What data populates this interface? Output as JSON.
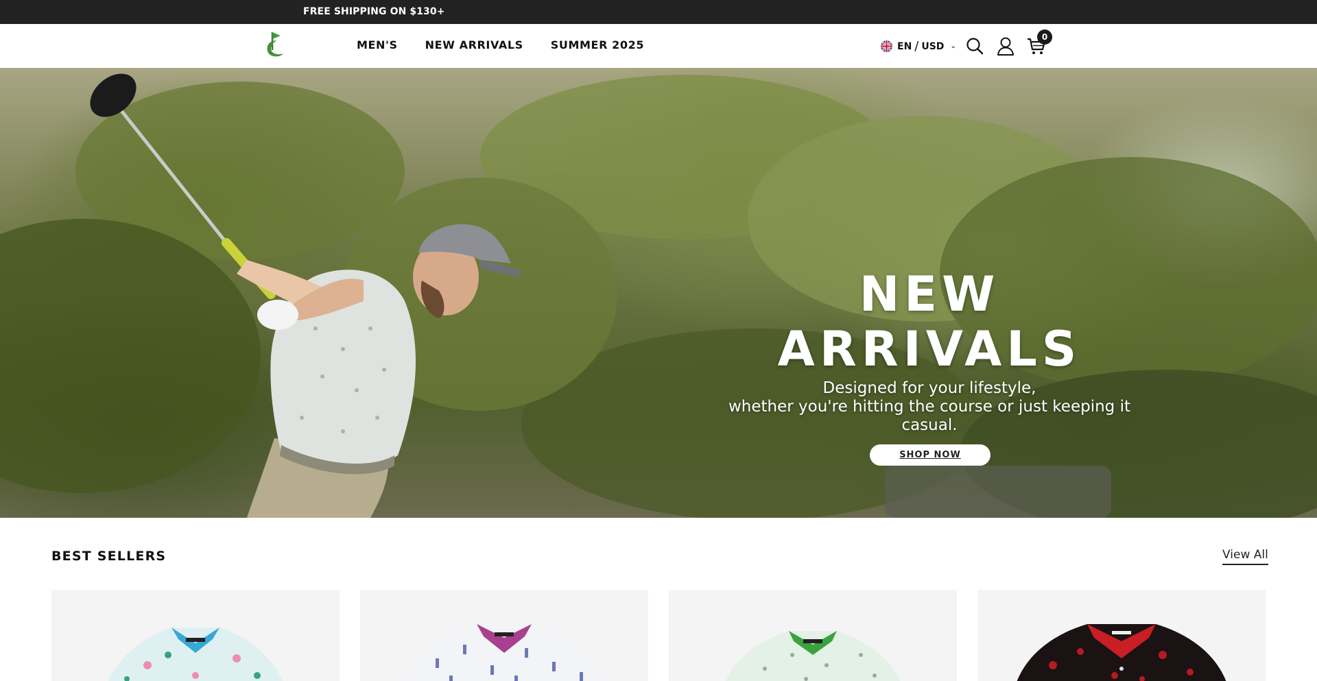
{
  "announcement": {
    "text": "FREE SHIPPING ON $130+"
  },
  "header": {
    "logo_icon": "golf-flag-logo-icon",
    "nav": [
      {
        "label": "MEN'S"
      },
      {
        "label": "NEW ARRIVALS"
      },
      {
        "label": "SUMMER 2025"
      }
    ],
    "locale": {
      "language": "EN",
      "separator": "/",
      "currency": "USD",
      "flag_icon": "uk-flag-icon"
    },
    "icons": {
      "search": "search-icon",
      "account": "user-icon",
      "cart": "cart-icon"
    },
    "cart_count": "0"
  },
  "hero": {
    "title": "NEW ARRIVALS",
    "subtitle_line1": "Designed for your lifestyle,",
    "subtitle_line2": "whether you're hitting the course or just keeping it casual.",
    "cta_label": "SHOP NOW"
  },
  "best_sellers": {
    "heading": "BEST SELLERS",
    "view_all_label": "View All",
    "products": [
      {
        "collar_color": "#35a9d6",
        "pattern": "flamingo-palm",
        "body_color": "#dff0f2"
      },
      {
        "collar_color": "#a8408f",
        "pattern": "bottle-print",
        "body_color": "#f3f4f7"
      },
      {
        "collar_color": "#3aa33d",
        "pattern": "mini-print",
        "body_color": "#e4f1e6"
      },
      {
        "collar_color": "#c81e24",
        "pattern": "red-floral",
        "body_color": "#1a1213"
      }
    ]
  },
  "colors": {
    "announce_bg": "#222222",
    "text_dark": "#111111"
  }
}
